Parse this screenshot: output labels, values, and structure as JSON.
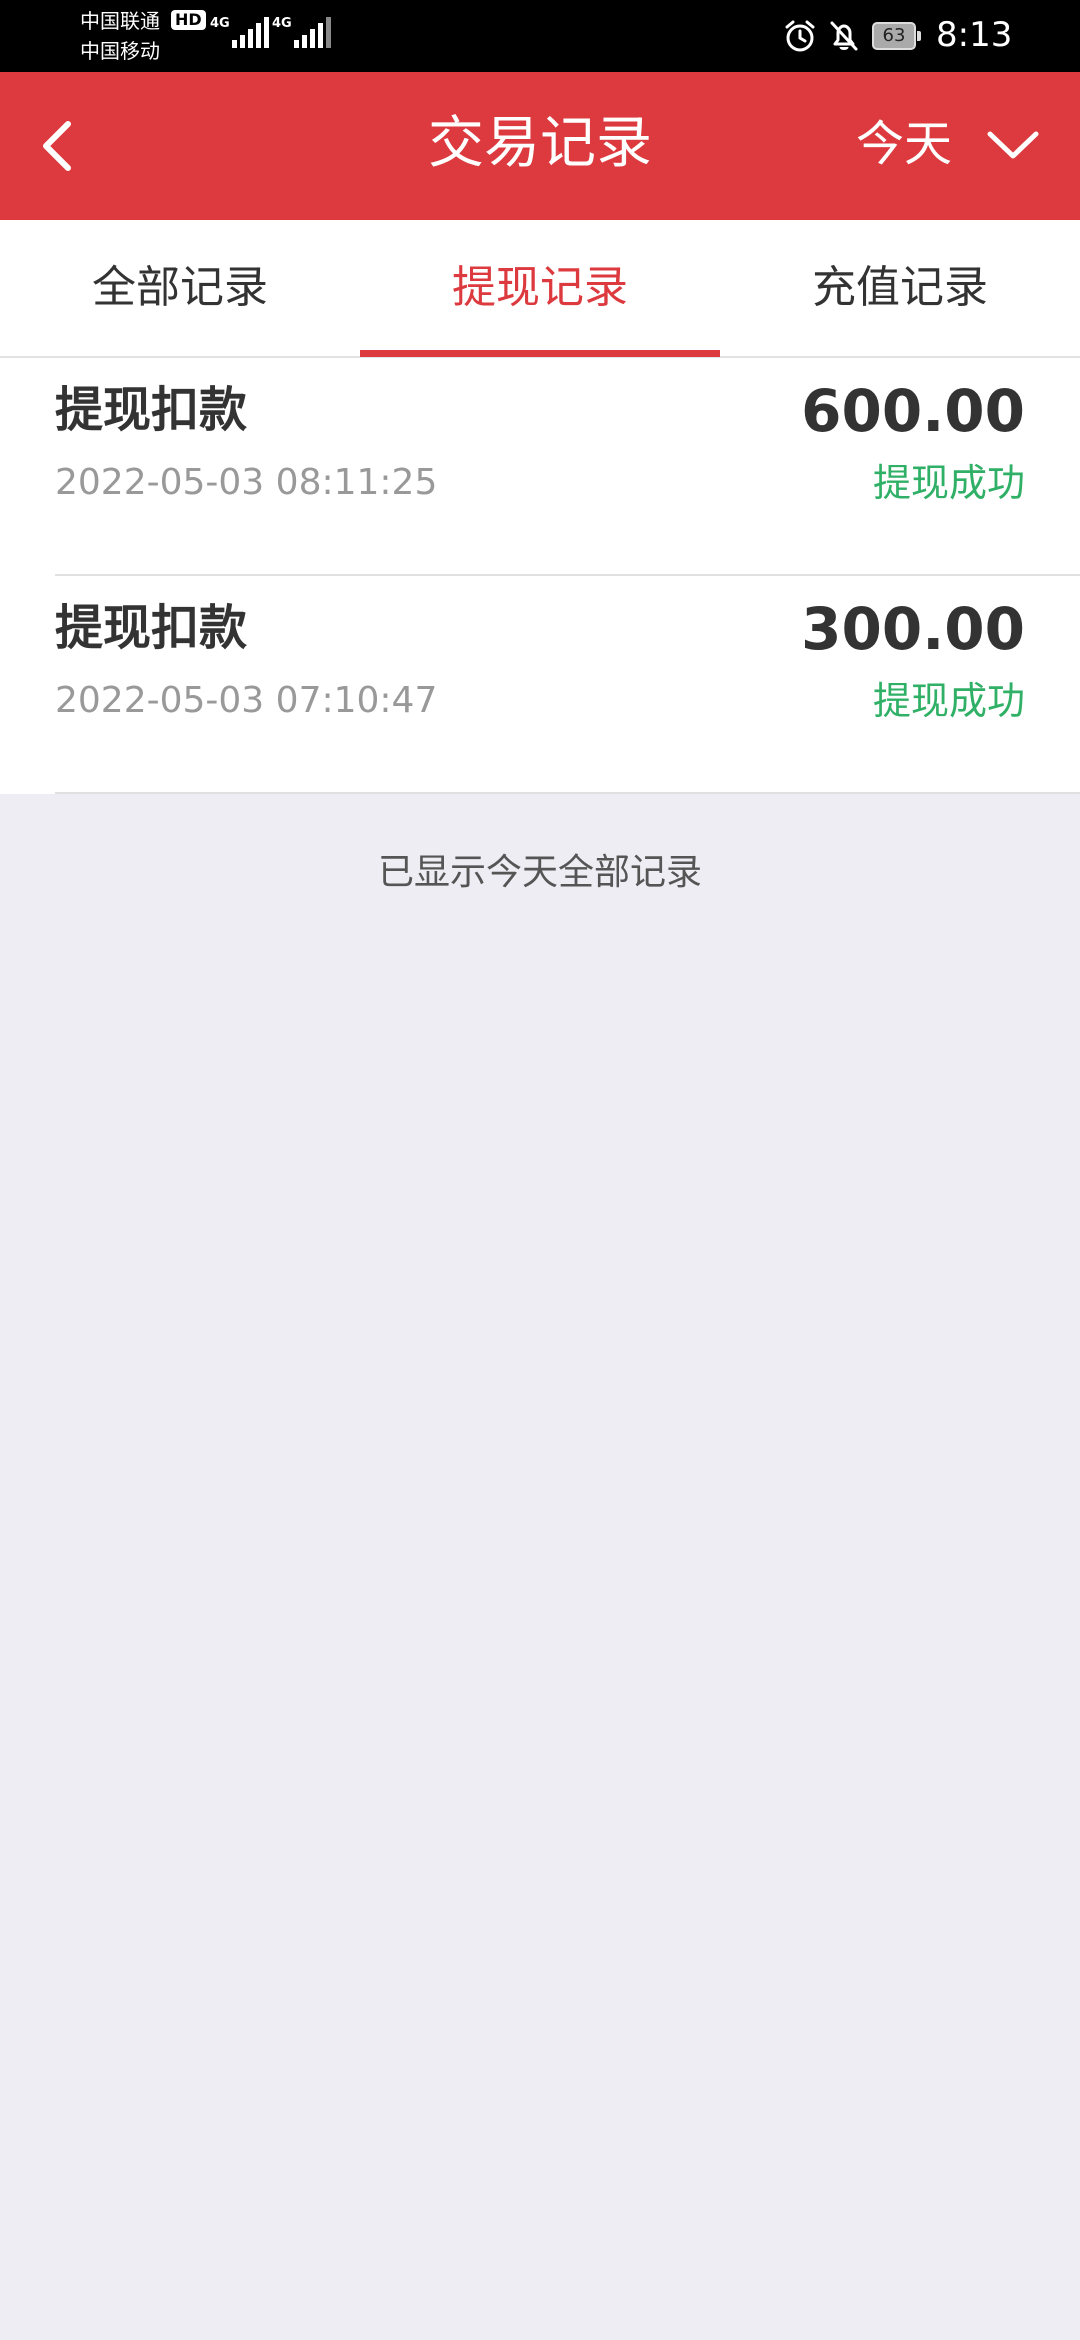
{
  "status_bar": {
    "carrier1": "中国联通",
    "carrier2": "中国移动",
    "hd_badge": "HD",
    "network1": "4G",
    "network2": "4G",
    "battery": "63",
    "time": "8:13",
    "icons": [
      "alarm-icon",
      "bell-off-icon",
      "battery-icon",
      "signal-icon"
    ]
  },
  "header": {
    "title": "交易记录",
    "filter_label": "今天",
    "icons": [
      "back-arrow-icon",
      "chevron-down-icon"
    ],
    "background_color": "#dc3a3e"
  },
  "tabs": [
    {
      "label": "全部记录",
      "active": false
    },
    {
      "label": "提现记录",
      "active": true
    },
    {
      "label": "充值记录",
      "active": false
    }
  ],
  "records": [
    {
      "title": "提现扣款",
      "time": "2022-05-03 08:11:25",
      "amount": "600.00",
      "status": "提现成功"
    },
    {
      "title": "提现扣款",
      "time": "2022-05-03 07:10:47",
      "amount": "300.00",
      "status": "提现成功"
    }
  ],
  "end_note": "已显示今天全部记录",
  "colors": {
    "accent": "#dc3a3e",
    "success": "#2fb066",
    "page_background": "#ededf3"
  }
}
